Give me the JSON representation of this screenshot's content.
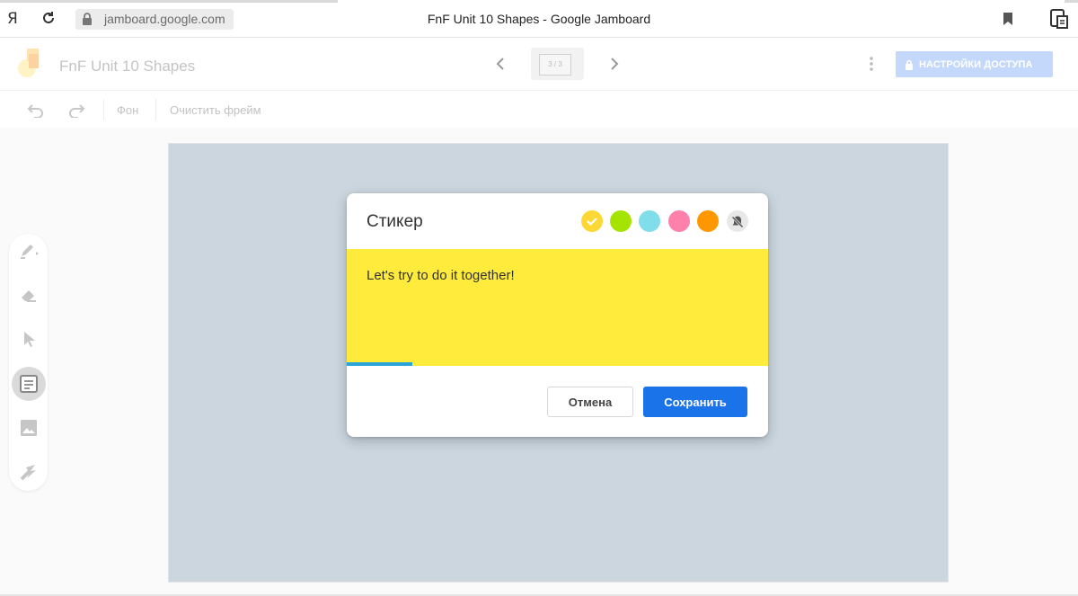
{
  "browser": {
    "url": "jamboard.google.com",
    "tab_title": "FnF Unit 10 Shapes - Google Jamboard",
    "yandex_label": "Я"
  },
  "header": {
    "doc_title": "FnF Unit 10 Shapes",
    "frame_counter": "3 / 3",
    "share_label": "НАСТРОЙКИ ДОСТУПА"
  },
  "toolbar": {
    "background_label": "Фон",
    "clear_frame_label": "Очистить фрейм"
  },
  "tools": [
    {
      "name": "pen-tool",
      "icon": "pen-icon"
    },
    {
      "name": "eraser-tool",
      "icon": "eraser-icon"
    },
    {
      "name": "select-tool",
      "icon": "pointer-icon"
    },
    {
      "name": "sticky-note-tool",
      "icon": "sticky-note-icon",
      "active": true
    },
    {
      "name": "image-tool",
      "icon": "image-icon"
    },
    {
      "name": "laser-tool",
      "icon": "laser-icon"
    }
  ],
  "dialog": {
    "title": "Стикер",
    "colors": [
      {
        "name": "yellow",
        "hex": "#fdd835",
        "selected": true
      },
      {
        "name": "green",
        "hex": "#a4e400"
      },
      {
        "name": "blue",
        "hex": "#80deea"
      },
      {
        "name": "pink",
        "hex": "#ff80ab"
      },
      {
        "name": "orange",
        "hex": "#ff9800"
      }
    ],
    "sticky_color": "#feeb3b",
    "sticky_text": "Let's try to do it together!",
    "progress": 0.155,
    "cancel_label": "Отмена",
    "save_label": "Сохранить"
  }
}
